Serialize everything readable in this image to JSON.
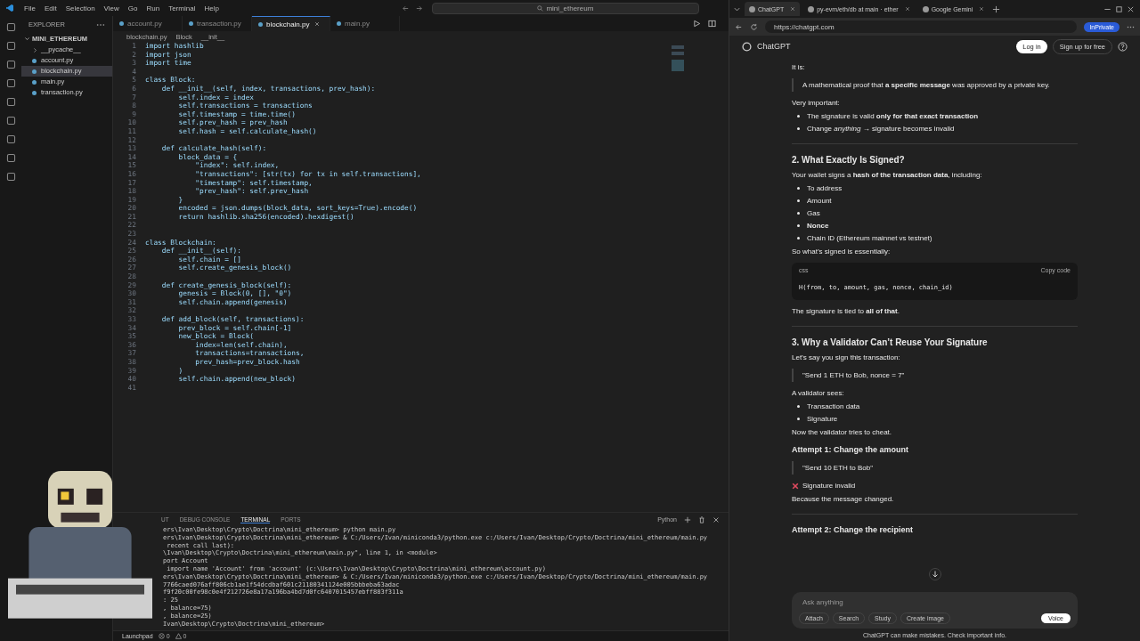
{
  "vscode": {
    "menu": [
      "File",
      "Edit",
      "Selection",
      "View",
      "Go",
      "Run",
      "Terminal",
      "Help"
    ],
    "command_center": {
      "placeholder": "mini_ethereum"
    },
    "explorer": {
      "title": "EXPLORER",
      "root": {
        "label": "MINI_ETHEREUM",
        "expanded": true,
        "children": [
          {
            "label": "__pycache__",
            "kind": "folder",
            "selected": false
          },
          {
            "label": "account.py",
            "kind": "file",
            "selected": false
          },
          {
            "label": "blockchain.py",
            "kind": "file",
            "selected": true
          },
          {
            "label": "main.py",
            "kind": "file",
            "selected": false
          },
          {
            "label": "transaction.py",
            "kind": "file",
            "selected": false
          }
        ]
      }
    },
    "tabs": [
      {
        "label": "account.py",
        "selected": false
      },
      {
        "label": "transaction.py",
        "selected": false
      },
      {
        "label": "blockchain.py",
        "selected": true
      },
      {
        "label": "main.py",
        "selected": false
      }
    ],
    "breadcrumb": [
      "blockchain.py",
      "Block",
      "__init__"
    ],
    "code_lines": [
      {
        "n": "1",
        "code": "import hashlib"
      },
      {
        "n": "2",
        "code": "import json"
      },
      {
        "n": "3",
        "code": "import time"
      },
      {
        "n": "4"
      },
      {
        "n": "5",
        "code": "class Block:"
      },
      {
        "n": "6",
        "code": "    def __init__(self, index, transactions, prev_hash):"
      },
      {
        "n": "7",
        "code": "        self.index = index"
      },
      {
        "n": "8",
        "code": "        self.transactions = transactions"
      },
      {
        "n": "9",
        "code": "        self.timestamp = time.time()"
      },
      {
        "n": "10",
        "code": "        self.prev_hash = prev_hash"
      },
      {
        "n": "11",
        "code": "        self.hash = self.calculate_hash()"
      },
      {
        "n": "12"
      },
      {
        "n": "13",
        "code": "    def calculate_hash(self):"
      },
      {
        "n": "14",
        "code": "        block_data = {"
      },
      {
        "n": "15",
        "code": "            \"index\": self.index,"
      },
      {
        "n": "16",
        "code": "            \"transactions\": [str(tx) for tx in self.transactions],"
      },
      {
        "n": "17",
        "code": "            \"timestamp\": self.timestamp,"
      },
      {
        "n": "18",
        "code": "            \"prev_hash\": self.prev_hash"
      },
      {
        "n": "19",
        "code": "        }"
      },
      {
        "n": "20",
        "code": "        encoded = json.dumps(block_data, sort_keys=True).encode()"
      },
      {
        "n": "21",
        "code": "        return hashlib.sha256(encoded).hexdigest()"
      },
      {
        "n": "22"
      },
      {
        "n": "23"
      },
      {
        "n": "24",
        "code": "class Blockchain:"
      },
      {
        "n": "25",
        "code": "    def __init__(self):"
      },
      {
        "n": "26",
        "code": "        self.chain = []"
      },
      {
        "n": "27",
        "code": "        self.create_genesis_block()"
      },
      {
        "n": "28"
      },
      {
        "n": "29",
        "code": "    def create_genesis_block(self):"
      },
      {
        "n": "30",
        "code": "        genesis = Block(0, [], \"0\")"
      },
      {
        "n": "31",
        "code": "        self.chain.append(genesis)"
      },
      {
        "n": "32"
      },
      {
        "n": "33",
        "code": "    def add_block(self, transactions):"
      },
      {
        "n": "34",
        "code": "        prev_block = self.chain[-1]"
      },
      {
        "n": "35",
        "code": "        new_block = Block("
      },
      {
        "n": "36",
        "code": "            index=len(self.chain),"
      },
      {
        "n": "37",
        "code": "            transactions=transactions,"
      },
      {
        "n": "38",
        "code": "            prev_hash=prev_block.hash"
      },
      {
        "n": "39",
        "code": "        )"
      },
      {
        "n": "40",
        "code": "        self.chain.append(new_block)"
      },
      {
        "n": "41"
      }
    ],
    "panel_tabs": [
      {
        "label": "UT",
        "selected": false
      },
      {
        "label": "DEBUG CONSOLE",
        "selected": false
      },
      {
        "label": "TERMINAL",
        "selected": true
      },
      {
        "label": "PORTS",
        "selected": false
      }
    ],
    "terminal_profile": "Python",
    "terminal_lines": [
      "ers\\Ivan\\Desktop\\Crypto\\Doctrina\\mini_ethereum> python main.py",
      "ers\\Ivan\\Desktop\\Crypto\\Doctrina\\mini_ethereum> & C:/Users/Ivan/miniconda3/python.exe c:/Users/Ivan/Desktop/Crypto/Doctrina/mini_ethereum/main.py",
      " recent call last):",
      "\\Ivan\\Desktop\\Crypto\\Doctrina\\mini_ethereum\\main.py\", line 1, in <module>",
      "port Account",
      " import name 'Account' from 'account' (c:\\Users\\Ivan\\Desktop\\Crypto\\Doctrina\\mini_ethereum\\account.py)",
      "ers\\Ivan\\Desktop\\Crypto\\Doctrina\\mini_ethereum> & C:/Users/Ivan/miniconda3/python.exe c:/Users/Ivan/Desktop/Crypto/Doctrina/mini_ethereum/main.py",
      "7766caed076aff806cb1ae1f54dcdbaf601c21180341124e005bbbeba63adac",
      "f9f20c00fe98c0e4f212726e8a17a196ba4bd7d0fc6407015457ebff883f311a",
      ": 25",
      ", balance=75)",
      ", balance=25)",
      "Ivan\\Desktop\\Crypto\\Doctrina\\mini_ethereum> "
    ],
    "status_bar": {
      "launchpad": "Launchpad",
      "errors": "0",
      "warnings": "0"
    }
  },
  "browser": {
    "tabs": [
      {
        "label": "ChatGPT",
        "selected": true
      },
      {
        "label": "py-evm/eth/db at main · ether",
        "selected": false
      },
      {
        "label": "Google Gemini",
        "selected": false
      }
    ],
    "address": "https://chatgpt.com",
    "profile": "InPrivate",
    "header": {
      "title": "ChatGPT",
      "login": "Log in",
      "signup": "Sign up for free"
    },
    "blocks": [
      {
        "kind": "p",
        "text": "It is:"
      },
      {
        "kind": "quote",
        "text": "A mathematical proof that **a specific message** was approved by a private key."
      },
      {
        "kind": "p",
        "text": "Very important:"
      },
      {
        "kind": "bullets",
        "items": [
          "The signature is valid **only for that exact transaction**",
          "Change *anything* → signature becomes invalid"
        ]
      },
      {
        "kind": "rule"
      },
      {
        "kind": "h2",
        "text": "2. What Exactly Is Signed?"
      },
      {
        "kind": "p",
        "text": "Your wallet signs a **hash of the transaction data**, including:"
      },
      {
        "kind": "bullets",
        "items": [
          "To address",
          "Amount",
          "Gas",
          "**Nonce**",
          "Chain ID (Ethereum mainnet vs testnet)"
        ]
      },
      {
        "kind": "p",
        "text": "So what’s signed is essentially:"
      },
      {
        "kind": "code",
        "lang": "css",
        "copy": "Copy code",
        "text": "H(from, to, amount, gas, nonce, chain_id)"
      },
      {
        "kind": "p",
        "text": "The signature is tied to **all of that**."
      },
      {
        "kind": "rule"
      },
      {
        "kind": "h2",
        "text": "3. Why a Validator Can’t Reuse Your Signature"
      },
      {
        "kind": "p",
        "text": "Let’s say you sign this transaction:"
      },
      {
        "kind": "quote",
        "text": "\"Send 1 ETH to Bob, nonce = 7\""
      },
      {
        "kind": "p",
        "text": "A validator sees:"
      },
      {
        "kind": "bullets",
        "items": [
          "Transaction data",
          "Signature"
        ]
      },
      {
        "kind": "p",
        "text": "Now the validator tries to cheat."
      },
      {
        "kind": "h3",
        "text": "Attempt 1: Change the amount"
      },
      {
        "kind": "quote",
        "text": "\"Send 10 ETH to Bob\""
      },
      {
        "kind": "cross",
        "text": "Signature invalid"
      },
      {
        "kind": "p",
        "text": "Because the message changed."
      },
      {
        "kind": "rule"
      },
      {
        "kind": "h3",
        "text": "Attempt 2: Change the recipient"
      }
    ],
    "composer": {
      "placeholder": "Ask anything",
      "tools": [
        "Attach",
        "Search",
        "Study",
        "Create image"
      ],
      "voice": "Voice"
    },
    "footer": "ChatGPT can make mistakes. Check important info."
  }
}
